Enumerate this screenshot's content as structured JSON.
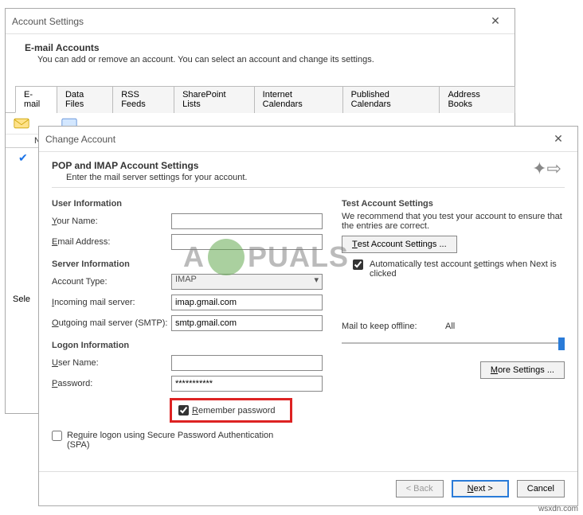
{
  "parent": {
    "title": "Account Settings",
    "heading": "E-mail Accounts",
    "sub": "You can add or remove an account. You can select an account and change its settings.",
    "tabs": [
      "E-mail",
      "Data Files",
      "RSS Feeds",
      "SharePoint Lists",
      "Internet Calendars",
      "Published Calendars",
      "Address Books"
    ],
    "listhead_name": "Na",
    "select_label": "Sele"
  },
  "dlg": {
    "title": "Change Account",
    "heading": "POP and IMAP Account Settings",
    "sub": "Enter the mail server settings for your account.",
    "grp_user": "User Information",
    "lbl_name": "Your Name:",
    "val_name": "",
    "lbl_email": "Email Address:",
    "val_email": "",
    "grp_server": "Server Information",
    "lbl_acct_type": "Account Type:",
    "val_acct_type": "IMAP",
    "lbl_incoming": "Incoming mail server:",
    "val_incoming": "imap.gmail.com",
    "lbl_outgoing": "Outgoing mail server (SMTP):",
    "val_outgoing": "smtp.gmail.com",
    "grp_logon": "Logon Information",
    "lbl_user": "User Name:",
    "val_user": "",
    "lbl_pass": "Password:",
    "val_pass": "***********",
    "lbl_remember": "Remember password",
    "lbl_spa": "Require logon using Secure Password Authentication (SPA)",
    "grp_test": "Test Account Settings",
    "test_text": "We recommend that you test your account to ensure that the entries are correct.",
    "btn_test": "Test Account Settings ...",
    "lbl_auto": "Automatically test account settings when Next is clicked",
    "lbl_offline": "Mail to keep offline:",
    "val_offline": "All",
    "btn_more": "More Settings ...",
    "btn_back": "< Back",
    "btn_next": "Next >",
    "btn_cancel": "Cancel"
  },
  "watermark": {
    "left": "A",
    "right": "PUALS"
  },
  "credit": "wsxdn.com"
}
